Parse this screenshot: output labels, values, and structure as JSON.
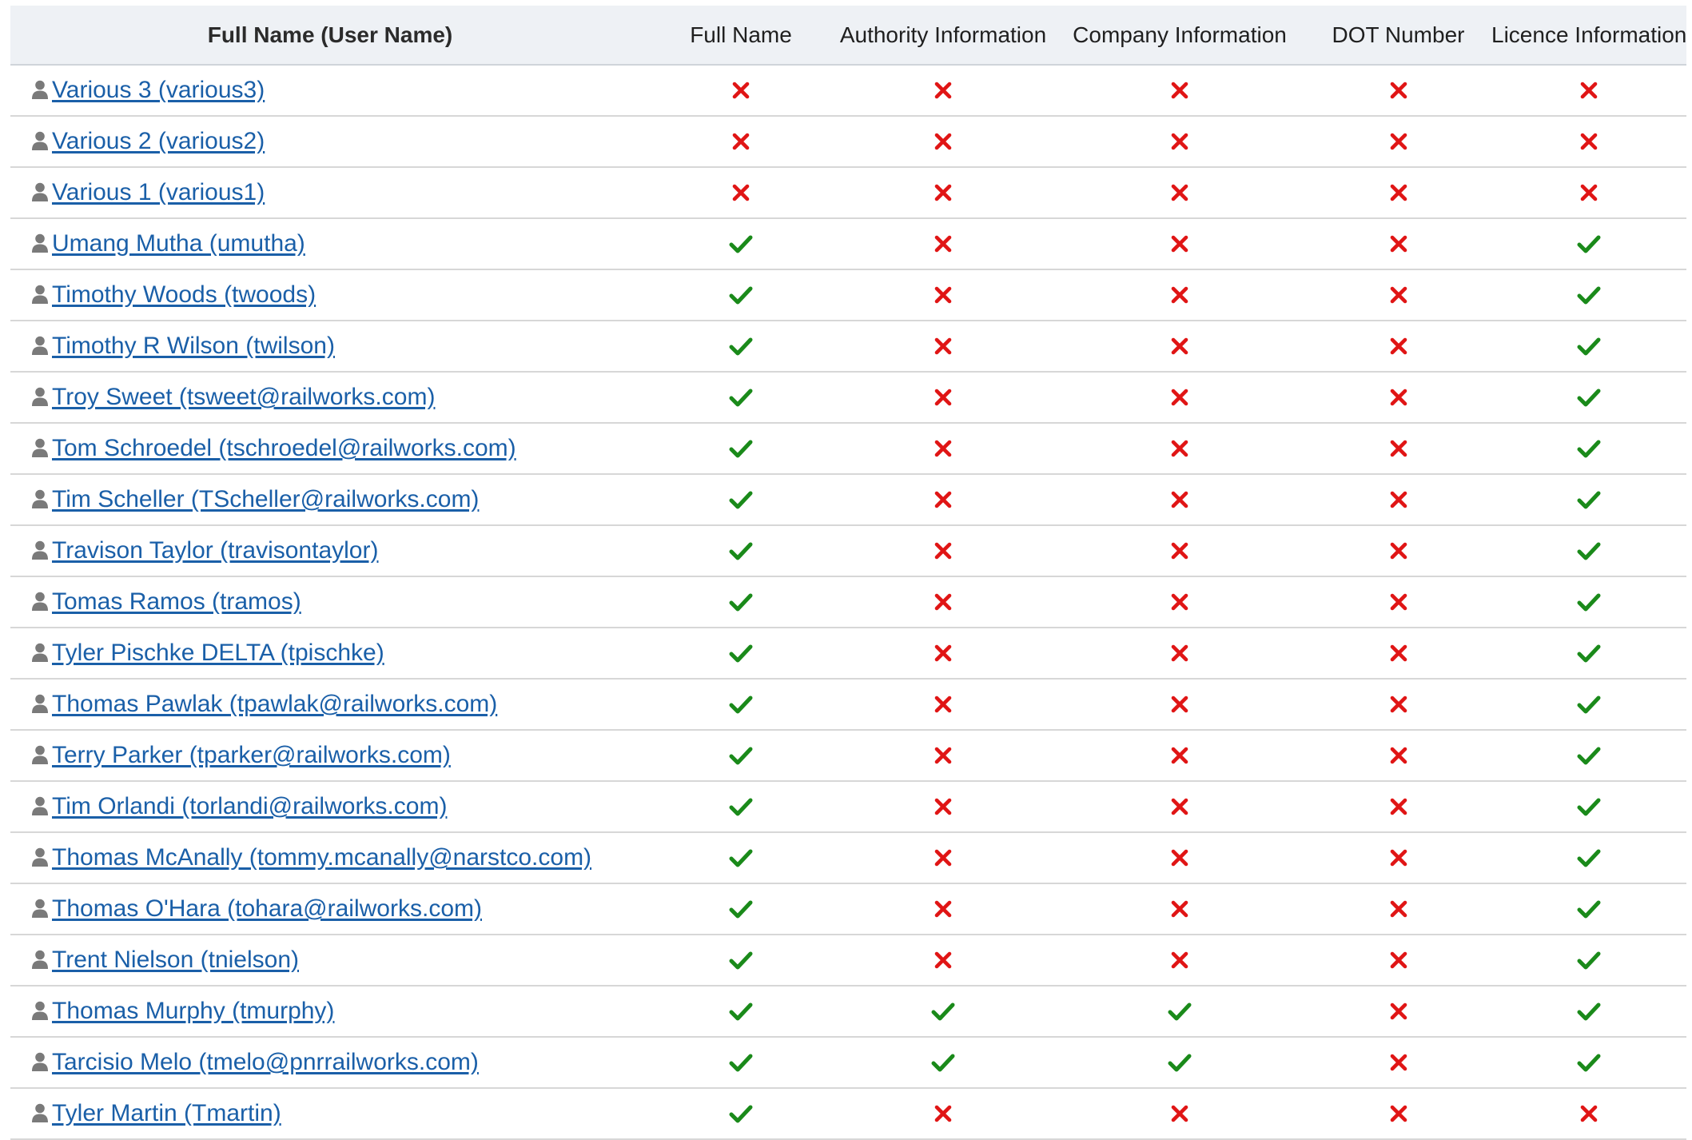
{
  "colors": {
    "header_bg": "#eef1f5",
    "link": "#1a5fa8",
    "check": "#1a8a1a",
    "cross": "#e01515",
    "user_icon": "#7a7a7a",
    "row_border": "#d7d7d7"
  },
  "icons": {
    "user": "user-icon",
    "yes": "check-icon",
    "no": "cross-icon"
  },
  "columns": [
    "Full Name (User Name)",
    "Full Name",
    "Authority Information",
    "Company Information",
    "DOT Number",
    "Licence Information"
  ],
  "rows": [
    {
      "user": "Various 3 (various3)",
      "full_name": false,
      "authority": false,
      "company": false,
      "dot": false,
      "licence": false
    },
    {
      "user": "Various 2 (various2)",
      "full_name": false,
      "authority": false,
      "company": false,
      "dot": false,
      "licence": false
    },
    {
      "user": "Various 1 (various1)",
      "full_name": false,
      "authority": false,
      "company": false,
      "dot": false,
      "licence": false
    },
    {
      "user": "Umang Mutha (umutha)",
      "full_name": true,
      "authority": false,
      "company": false,
      "dot": false,
      "licence": true
    },
    {
      "user": "Timothy Woods (twoods)",
      "full_name": true,
      "authority": false,
      "company": false,
      "dot": false,
      "licence": true
    },
    {
      "user": "Timothy R Wilson (twilson)",
      "full_name": true,
      "authority": false,
      "company": false,
      "dot": false,
      "licence": true
    },
    {
      "user": "Troy Sweet (tsweet@railworks.com)",
      "full_name": true,
      "authority": false,
      "company": false,
      "dot": false,
      "licence": true
    },
    {
      "user": "Tom Schroedel (tschroedel@railworks.com)",
      "full_name": true,
      "authority": false,
      "company": false,
      "dot": false,
      "licence": true
    },
    {
      "user": "Tim Scheller (TScheller@railworks.com)",
      "full_name": true,
      "authority": false,
      "company": false,
      "dot": false,
      "licence": true
    },
    {
      "user": "Travison Taylor (travisontaylor)",
      "full_name": true,
      "authority": false,
      "company": false,
      "dot": false,
      "licence": true
    },
    {
      "user": "Tomas Ramos (tramos)",
      "full_name": true,
      "authority": false,
      "company": false,
      "dot": false,
      "licence": true
    },
    {
      "user": "Tyler Pischke DELTA (tpischke)",
      "full_name": true,
      "authority": false,
      "company": false,
      "dot": false,
      "licence": true
    },
    {
      "user": "Thomas Pawlak (tpawlak@railworks.com)",
      "full_name": true,
      "authority": false,
      "company": false,
      "dot": false,
      "licence": true
    },
    {
      "user": "Terry Parker (tparker@railworks.com)",
      "full_name": true,
      "authority": false,
      "company": false,
      "dot": false,
      "licence": true
    },
    {
      "user": "Tim Orlandi (torlandi@railworks.com)",
      "full_name": true,
      "authority": false,
      "company": false,
      "dot": false,
      "licence": true
    },
    {
      "user": "Thomas McAnally (tommy.mcanally@narstco.com)",
      "full_name": true,
      "authority": false,
      "company": false,
      "dot": false,
      "licence": true
    },
    {
      "user": "Thomas O'Hara (tohara@railworks.com)",
      "full_name": true,
      "authority": false,
      "company": false,
      "dot": false,
      "licence": true
    },
    {
      "user": "Trent Nielson (tnielson)",
      "full_name": true,
      "authority": false,
      "company": false,
      "dot": false,
      "licence": true
    },
    {
      "user": "Thomas Murphy (tmurphy)",
      "full_name": true,
      "authority": true,
      "company": true,
      "dot": false,
      "licence": true
    },
    {
      "user": "Tarcisio Melo (tmelo@pnrrailworks.com)",
      "full_name": true,
      "authority": true,
      "company": true,
      "dot": false,
      "licence": true
    },
    {
      "user": "Tyler Martin (Tmartin)",
      "full_name": true,
      "authority": false,
      "company": false,
      "dot": false,
      "licence": false
    }
  ]
}
